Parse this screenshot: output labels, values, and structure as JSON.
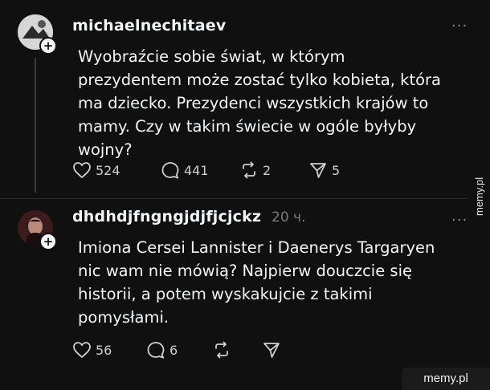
{
  "posts": [
    {
      "username": "michaelnechitaev",
      "time": "",
      "text": "Wyobraźcie sobie świat, w którym\nprezydentem może zostać tylko kobieta, która\nma dziecko. Prezydenci wszystkich krajów to\nmamy. Czy w takim świecie w ogóle byłyby\nwojny?",
      "likes": "524",
      "comments": "441",
      "reposts": "2",
      "shares": "5"
    },
    {
      "username": "dhdhdjfngngjdjfjcjckz",
      "time": "20 ч.",
      "text": "Imiona Cersei Lannister i Daenerys Targaryen\nnic wam nie mówią? Najpierw douczcie się\nhistorii, a potem wyskakujcie z takimi\npomysłami.",
      "likes": "56",
      "comments": "6",
      "reposts": "",
      "shares": ""
    }
  ],
  "more_glyph": "···",
  "plus_glyph": "+",
  "icons": [
    "heart-icon",
    "comment-icon",
    "repost-icon",
    "share-icon",
    "more-icon",
    "follow-plus-icon"
  ],
  "watermark": {
    "side": "memy.pl",
    "corner": "memy.pl"
  },
  "colors": {
    "background": "#101010",
    "text": "#f3f5f7",
    "muted": "#7a7a7a"
  }
}
